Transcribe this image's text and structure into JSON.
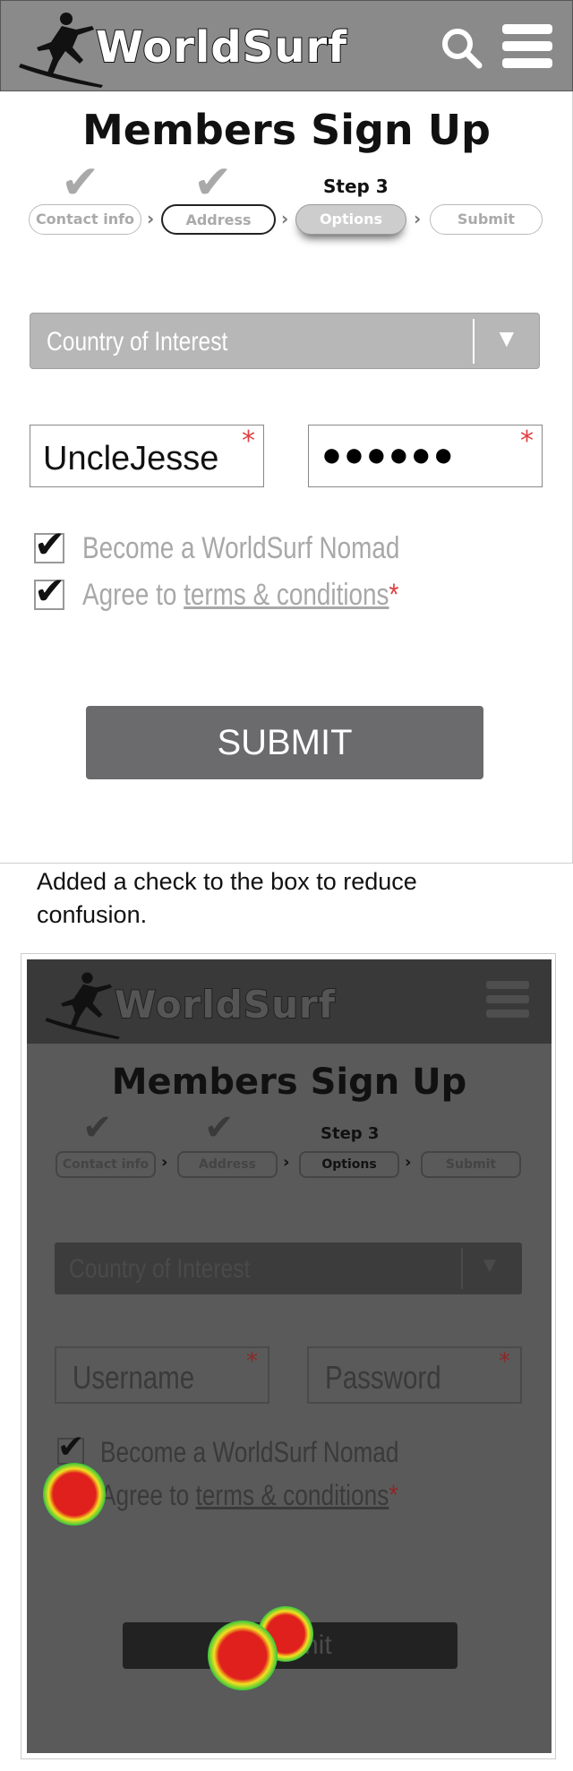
{
  "mockup_top": {
    "header": {
      "brand": "WorldSurf",
      "logo_icon": "surfer-logo-icon",
      "search_icon": "search-icon",
      "menu_icon": "hamburger-menu-icon"
    },
    "title": "Members Sign Up",
    "steps": [
      {
        "label": "Contact info",
        "completed": true
      },
      {
        "label": "Address",
        "completed": true
      },
      {
        "label": "Options",
        "current": true,
        "step_label": "Step 3"
      },
      {
        "label": "Submit"
      }
    ],
    "country_select": {
      "placeholder": "Country of Interest"
    },
    "username": {
      "value": "UncleJesse",
      "required_mark": "*"
    },
    "password": {
      "masked_value": "●●●●●●",
      "required_mark": "*"
    },
    "options": [
      {
        "label": "Become a WorldSurf Nomad",
        "checked": true
      },
      {
        "label_prefix": "Agree to ",
        "link_text": "terms & conditions",
        "required_mark": "*",
        "checked": true
      }
    ],
    "submit_label": "SUBMIT"
  },
  "caption": "Added a check to the box to reduce confusion.",
  "mockup_heatmap": {
    "header": {
      "brand": "WorldSurf",
      "logo_icon": "surfer-logo-icon",
      "menu_icon": "hamburger-menu-icon"
    },
    "title": "Members Sign Up",
    "steps": [
      {
        "label": "Contact info",
        "completed": true
      },
      {
        "label": "Address",
        "completed": true
      },
      {
        "label": "Options",
        "current": true,
        "step_label": "Step 3"
      },
      {
        "label": "Submit"
      }
    ],
    "country_select": {
      "placeholder": "Country of Interest"
    },
    "username": {
      "placeholder": "Username",
      "required_mark": "*"
    },
    "password": {
      "placeholder": "Password",
      "required_mark": "*"
    },
    "options": [
      {
        "label": "Become a WorldSurf Nomad",
        "checked": true
      },
      {
        "label_prefix": "Agree to ",
        "link_text": "terms & conditions",
        "required_mark": "*",
        "checked": false
      }
    ],
    "submit_label": "Submit",
    "heat_colors": [
      "#e0201c",
      "#f4e020",
      "#3fc83a",
      "#1f4fd8"
    ]
  }
}
